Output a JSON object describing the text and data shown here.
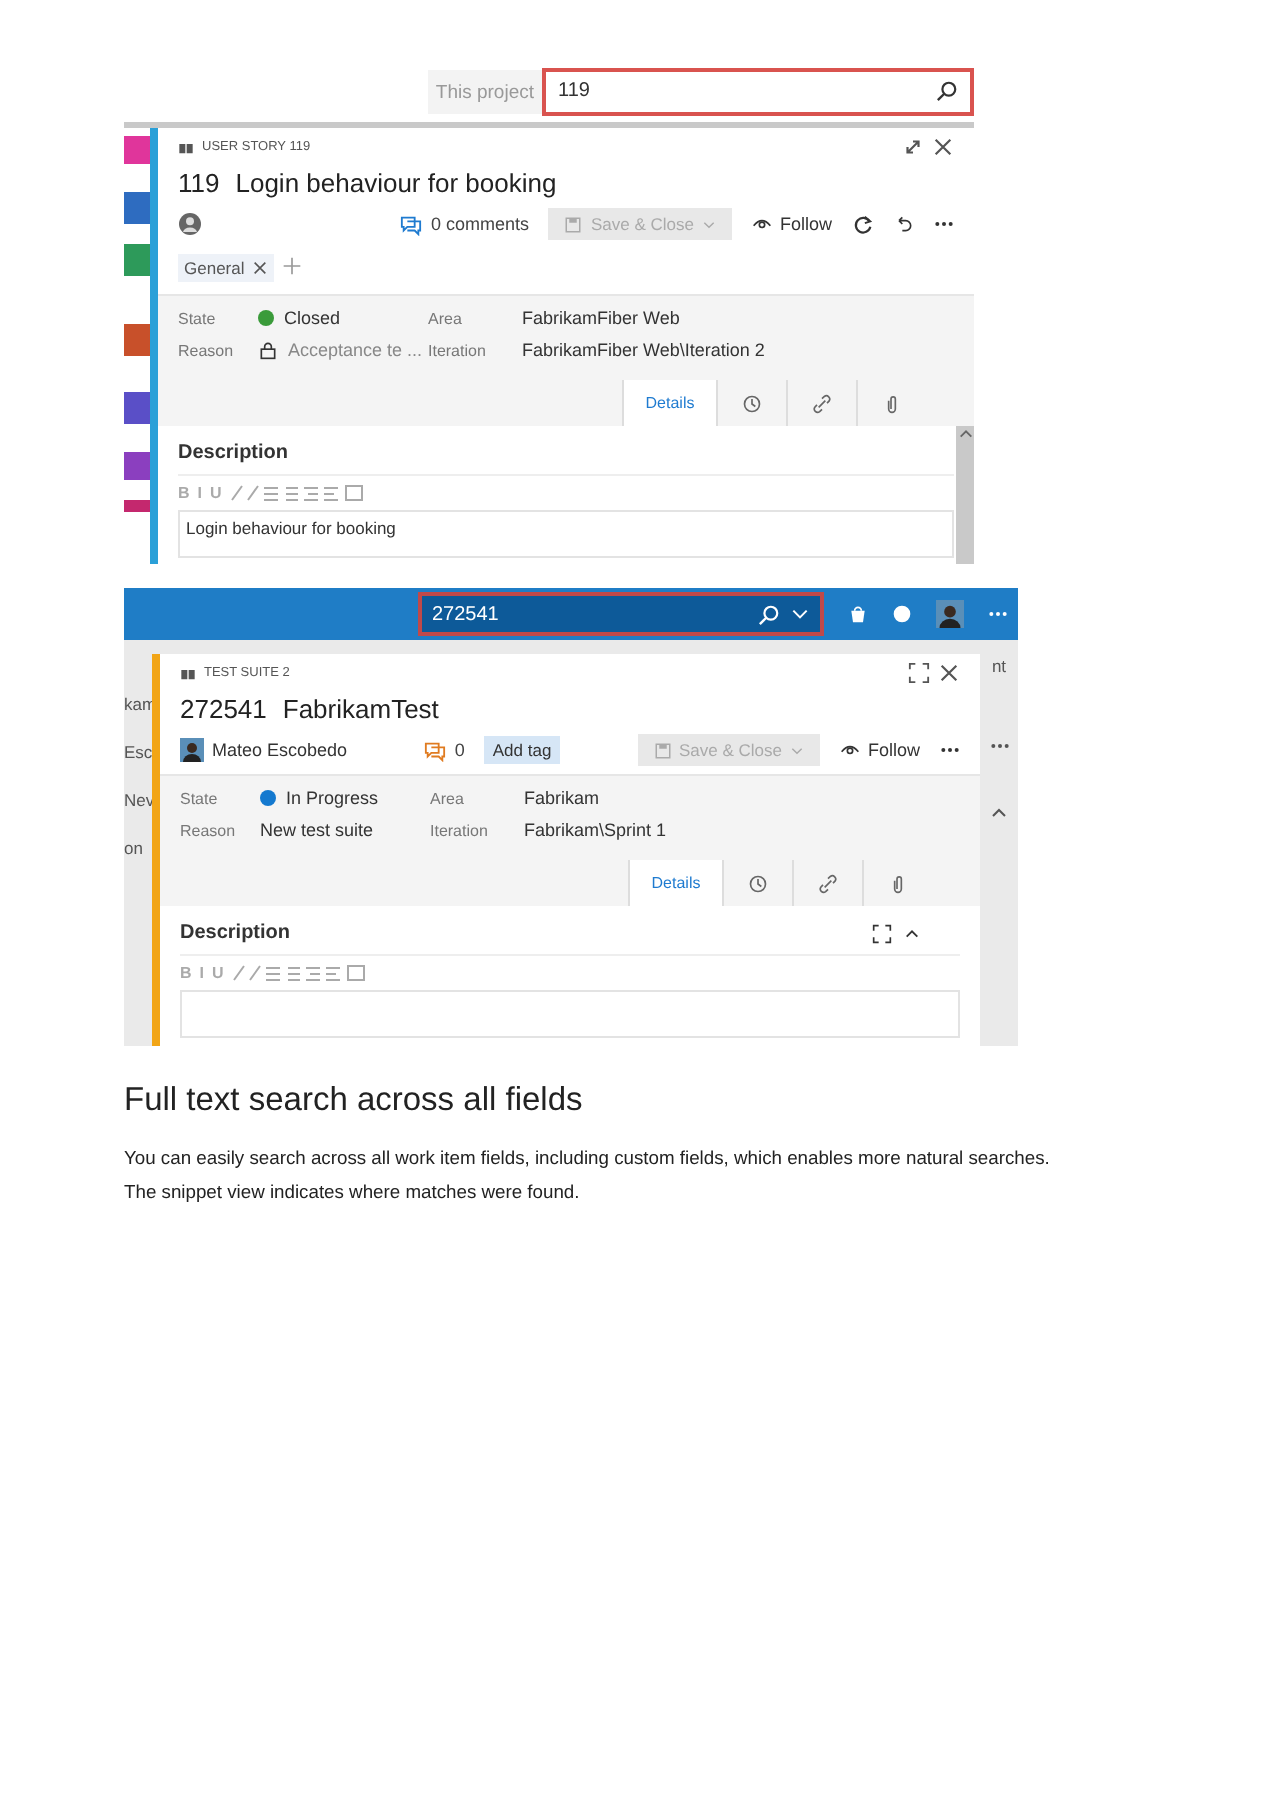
{
  "screenshots": [
    {
      "kind": "light",
      "search": {
        "scope": "This project",
        "value": "119"
      },
      "work_item": {
        "color": "#2aa0d8",
        "type_label": "USER STORY 119",
        "id": "119",
        "title": "Login behaviour for booking",
        "comments": "0 comments",
        "save_label": "Save & Close",
        "save_disabled": true,
        "follow_label": "Follow",
        "tags": [
          {
            "label": "General"
          }
        ],
        "fields": [
          {
            "label": "State",
            "value": "Closed",
            "color": "#3a9b3a",
            "locked": false
          },
          {
            "label": "Area",
            "value": "FabrikamFiber Web",
            "locked": false
          },
          {
            "label": "Reason",
            "value": "Acceptance te ...",
            "locked": true
          },
          {
            "label": "Iteration",
            "value": "FabrikamFiber Web\\Iteration 2",
            "locked": false
          }
        ],
        "tabs": [
          {
            "kind": "text",
            "label": "Details",
            "selected": true
          },
          {
            "kind": "history",
            "selected": false
          },
          {
            "kind": "link",
            "selected": false
          },
          {
            "kind": "attachment",
            "selected": false
          }
        ],
        "description": {
          "heading": "Description",
          "format_letters": [
            "B",
            "I",
            "U"
          ],
          "text": "Login behaviour for booking"
        }
      }
    },
    {
      "kind": "dark",
      "search": {
        "value": "272541"
      },
      "left_background_texts": [
        "kam",
        "Esc",
        "Nev",
        "on"
      ],
      "right_background_texts": [
        "nt"
      ],
      "work_item": {
        "color": "#f2a516",
        "type_label": "TEST SUITE 2",
        "id": "272541",
        "title": "FabrikamTest",
        "assignee": "Mateo Escobedo",
        "comments": "0",
        "add_tag_label": "Add tag",
        "save_label": "Save & Close",
        "save_disabled": true,
        "follow_label": "Follow",
        "fields": [
          {
            "label": "State",
            "value": "In Progress",
            "color": "#1479cf",
            "locked": false
          },
          {
            "label": "Area",
            "value": "Fabrikam",
            "locked": false
          },
          {
            "label": "Reason",
            "value": "New test suite",
            "locked": false
          },
          {
            "label": "Iteration",
            "value": "Fabrikam\\Sprint 1",
            "locked": false
          }
        ],
        "tabs": [
          {
            "kind": "text",
            "label": "Details",
            "selected": true
          },
          {
            "kind": "history",
            "selected": false
          },
          {
            "kind": "link",
            "selected": false
          },
          {
            "kind": "attachment",
            "selected": false
          }
        ],
        "description": {
          "heading": "Description",
          "format_letters": [
            "B",
            "I",
            "U"
          ]
        }
      }
    }
  ],
  "heading": "Full text search across all fields",
  "sentences": [
    "You can easily search across all work item fields, including custom fields, which enables more natural searches.",
    "The snippet view indicates where matches were found."
  ]
}
